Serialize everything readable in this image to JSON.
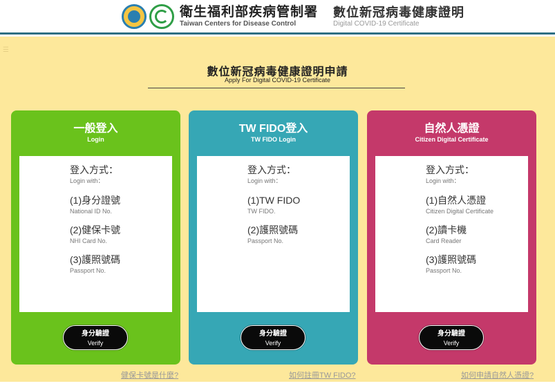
{
  "header": {
    "org_zh": "衛生福利部疾病管制署",
    "org_en": "Taiwan Centers for Disease Control",
    "cert_zh": "數位新冠病毒健康證明",
    "cert_en": "Digital COVID-19 Certificate"
  },
  "page": {
    "title": "數位新冠病毒健康證明申請",
    "subtitle": "Apply For Digital COVID-19 Certificate"
  },
  "colors": {
    "background": "#fde89b",
    "card_general": "#6ac21c",
    "card_fido": "#36a7b5",
    "card_citizen": "#c4396a",
    "header_rule": "#2e6f84"
  },
  "cards": [
    {
      "title": "一般登入",
      "subtitle": "Login",
      "login_with_zh": "登入方式：",
      "login_with_en": "Login with：",
      "options": [
        {
          "zh": "(1)身分證號",
          "en": "National ID No."
        },
        {
          "zh": "(2)健保卡號",
          "en": "NHI Card No."
        },
        {
          "zh": "(3)護照號碼",
          "en": "Passport No."
        }
      ],
      "button_zh": "身分驗證",
      "button_en": "Verify"
    },
    {
      "title": "TW FIDO登入",
      "subtitle": "TW FIDO Login",
      "login_with_zh": "登入方式：",
      "login_with_en": "Login with：",
      "options": [
        {
          "zh": "(1)TW FIDO",
          "en": "TW FIDO."
        },
        {
          "zh": "(2)護照號碼",
          "en": "Passport No."
        }
      ],
      "button_zh": "身分驗證",
      "button_en": "Verify"
    },
    {
      "title": "自然人憑證",
      "subtitle": "Citizen Digital Certificate",
      "login_with_zh": "登入方式：",
      "login_with_en": "Login with：",
      "options": [
        {
          "zh": "(1)自然人憑證",
          "en": "Citizen Digital Certificate"
        },
        {
          "zh": "(2)讀卡機",
          "en": "Card Reader"
        },
        {
          "zh": "(3)護照號碼",
          "en": "Passport No."
        }
      ],
      "button_zh": "身分驗證",
      "button_en": "Verify"
    }
  ],
  "links": {
    "nhi_card": "健保卡號是什麼?",
    "register_fido": "如何註冊TW FIDO?",
    "apply_citizen": "如何申請自然人憑證?"
  }
}
